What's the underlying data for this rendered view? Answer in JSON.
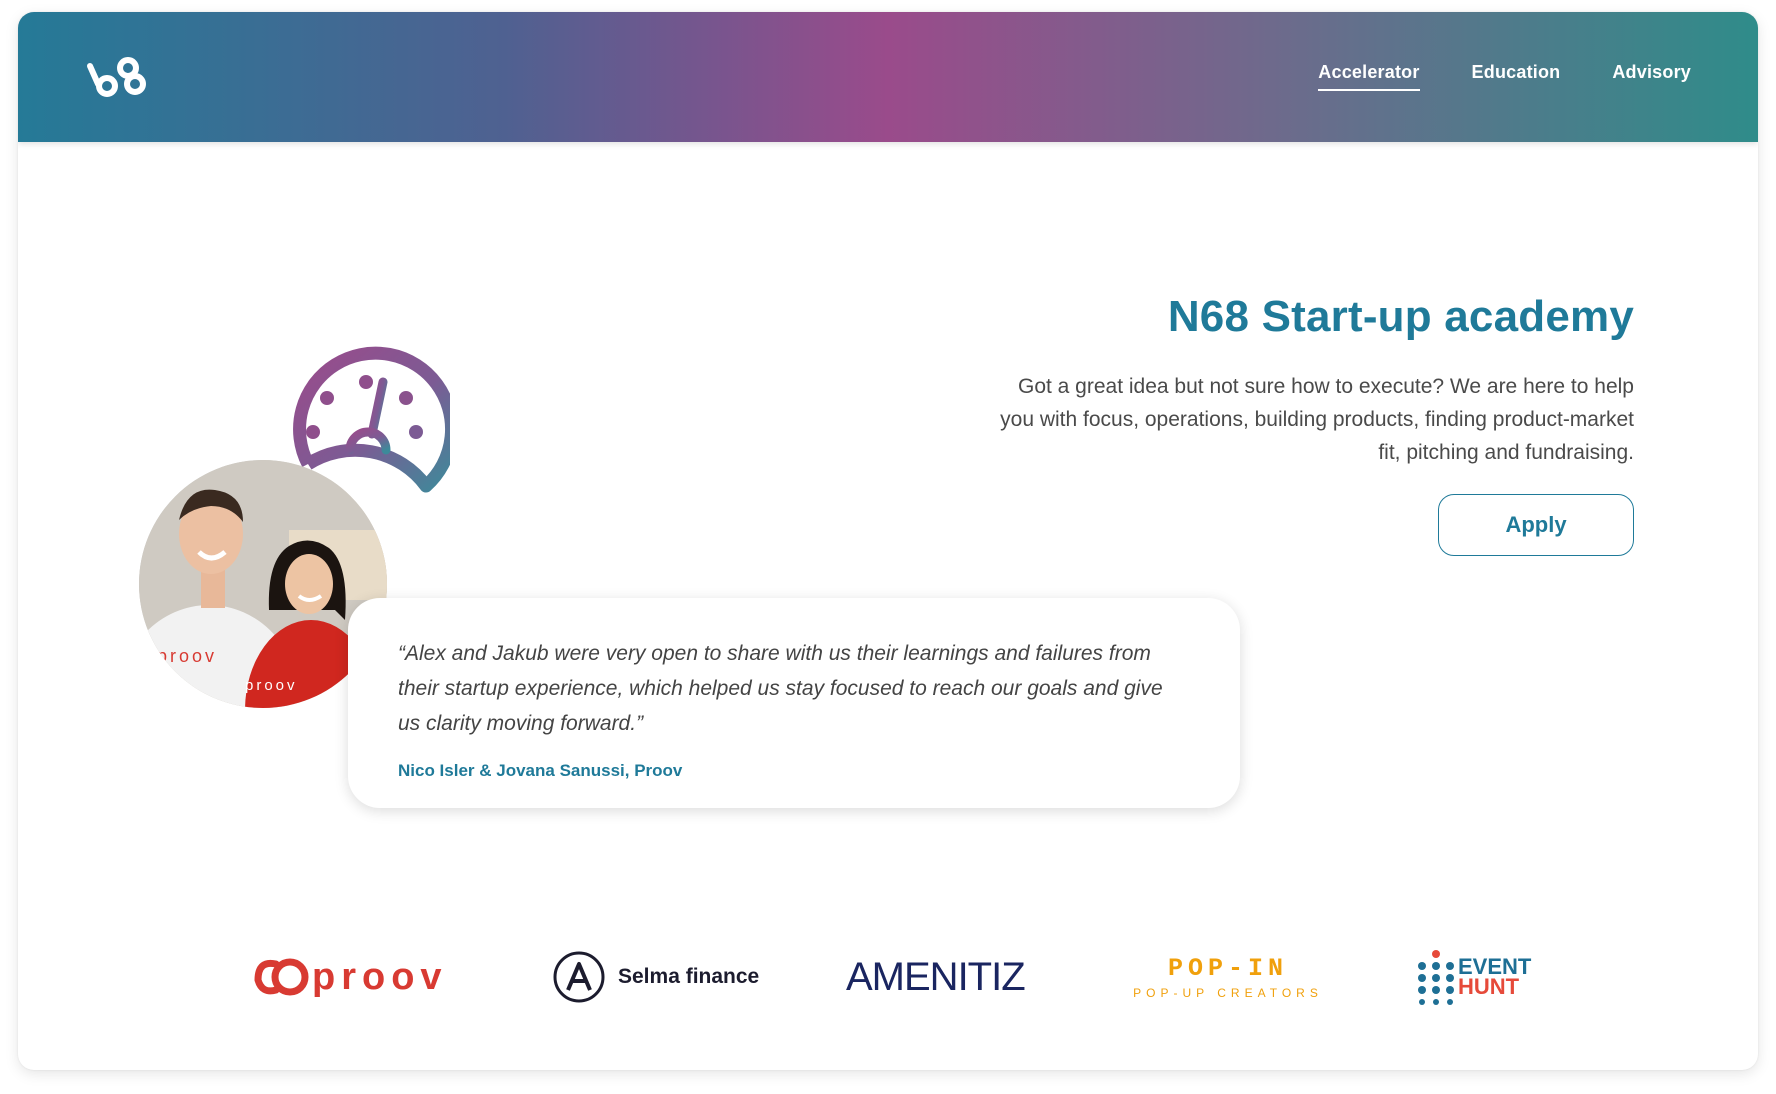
{
  "nav": {
    "items": [
      {
        "label": "Accelerator",
        "active": true
      },
      {
        "label": "Education",
        "active": false
      },
      {
        "label": "Advisory",
        "active": false
      }
    ]
  },
  "hero": {
    "title": "N68 Start-up academy",
    "description": "Got a great idea but not sure how to execute? We are here to help you with focus, operations, building products, finding product-market fit, pitching and fundraising.",
    "apply_label": "Apply"
  },
  "testimonial": {
    "quote": "“Alex and Jakub were very open to share with us their learnings and failures from their startup experience, which helped us stay focused to reach our goals and give us clarity moving forward.”",
    "author": "Nico Isler & Jovana Sanussi, Proov",
    "photo_shirt_text_1": "proov",
    "photo_shirt_text_2": "proov"
  },
  "partners": {
    "proov": "proov",
    "selma": "Selma finance",
    "amenitiz": "AMENITIZ",
    "popin_main": "POP-IN",
    "popin_sub": "POP-UP CREATORS",
    "event_top": "EVENT",
    "event_bottom": "HUNT"
  },
  "colors": {
    "brand_teal": "#1f7a99",
    "gradient_start": "#257a97",
    "gradient_mid": "#9a4b8b",
    "gradient_end": "#2f8c8a",
    "proov_red": "#d83a32",
    "popin_orange": "#f0a00c"
  }
}
